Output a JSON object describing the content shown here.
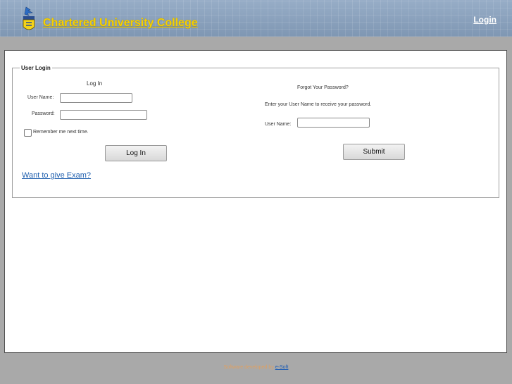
{
  "header": {
    "title": "Chartered University College",
    "login_link": "Login"
  },
  "login_panel": {
    "legend": "User Login",
    "heading": "Log In",
    "username_label": "User Name:",
    "password_label": "Password:",
    "username_value": "",
    "password_value": "",
    "remember_label": "Remember me next time.",
    "remember_checked": false,
    "login_button": "Log In",
    "exam_link": "Want to give Exam?"
  },
  "forgot_panel": {
    "heading": "Forgot Your Password?",
    "instruction": "Enter your User Name to receive your password.",
    "username_label": "User Name:",
    "username_value": "",
    "submit_button": "Submit"
  },
  "footer": {
    "text": "Software developed by ",
    "link": "e-Soft"
  }
}
